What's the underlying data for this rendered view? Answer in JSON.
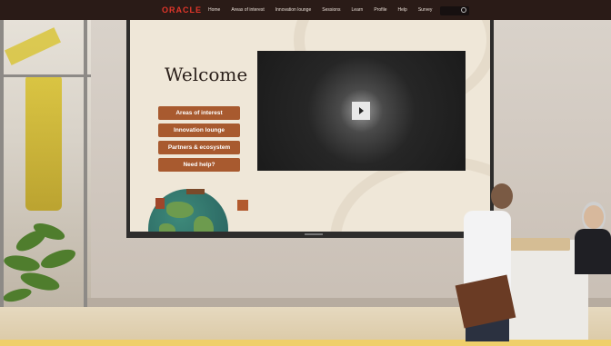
{
  "nav": {
    "logo": "ORACLE",
    "items": [
      "Home",
      "Areas of interest",
      "Innovation lounge",
      "Sessions",
      "Learn",
      "Profile",
      "Help",
      "Survey"
    ]
  },
  "screen": {
    "welcome": "Welcome",
    "buttons": [
      "Areas of interest",
      "Innovation lounge",
      "Partners & ecosystem",
      "Need help?"
    ]
  },
  "colors": {
    "nav_bg": "#2a1b17",
    "brand_red": "#e0362a",
    "button_brown": "#a85a2f",
    "screen_bg": "#efe7d8",
    "footer_yellow": "#efcf6a"
  }
}
